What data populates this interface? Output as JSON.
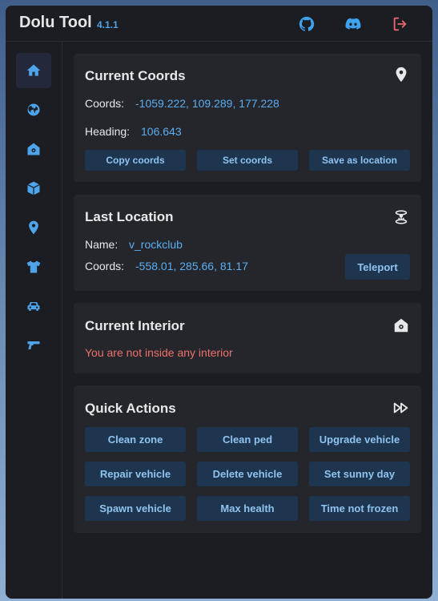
{
  "app": {
    "title": "Dolu Tool",
    "version": "4.1.1"
  },
  "titlebar_icons": [
    "github-icon",
    "discord-icon",
    "logout-icon"
  ],
  "sidebar": {
    "items": [
      {
        "icon": "home-icon",
        "active": true
      },
      {
        "icon": "globe-icon",
        "active": false
      },
      {
        "icon": "interior-house-icon",
        "active": false
      },
      {
        "icon": "cube-icon",
        "active": false
      },
      {
        "icon": "location-pin-icon",
        "active": false
      },
      {
        "icon": "tshirt-icon",
        "active": false
      },
      {
        "icon": "car-icon",
        "active": false
      },
      {
        "icon": "gun-icon",
        "active": false
      }
    ]
  },
  "current_coords": {
    "title": "Current Coords",
    "coords_label": "Coords:",
    "coords_value": "-1059.222, 109.289, 177.228",
    "heading_label": "Heading:",
    "heading_value": "106.643",
    "buttons": [
      "Copy coords",
      "Set coords",
      "Save as location"
    ]
  },
  "last_location": {
    "title": "Last Location",
    "name_label": "Name:",
    "name_value": "v_rockclub",
    "coords_label": "Coords:",
    "coords_value": "-558.01, 285.66, 81.17",
    "teleport_label": "Teleport"
  },
  "current_interior": {
    "title": "Current Interior",
    "message": "You are not inside any interior"
  },
  "quick_actions": {
    "title": "Quick Actions",
    "buttons": [
      "Clean zone",
      "Clean ped",
      "Upgrade vehicle",
      "Repair vehicle",
      "Delete vehicle",
      "Set sunny day",
      "Spawn vehicle",
      "Max health",
      "Time not frozen"
    ]
  },
  "colors": {
    "accent": "#4ea4ea",
    "button_bg": "#1e3550",
    "warning": "#f0706a"
  }
}
